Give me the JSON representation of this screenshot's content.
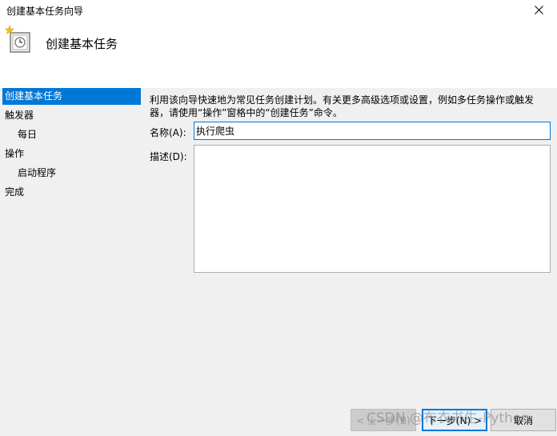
{
  "window": {
    "title": "创建基本任务向导"
  },
  "header": {
    "title": "创建基本任务",
    "icon": "task-scheduler-clock-icon"
  },
  "nav": {
    "items": [
      {
        "label": "创建基本任务",
        "active": true
      },
      {
        "label": "触发器"
      },
      {
        "label": "每日"
      },
      {
        "label": "操作"
      },
      {
        "label": "启动程序"
      },
      {
        "label": "完成"
      }
    ]
  },
  "main": {
    "description": "利用该向导快速地为常见任务创建计划。有关更多高级选项或设置，例如多任务操作或触发器，请使用“操作”窗格中的“创建任务”命令。",
    "name_label": "名称(A):",
    "name_value": "执行爬虫",
    "desc_label": "描述(D):",
    "desc_value": ""
  },
  "buttons": {
    "back": "< 上一步(B)",
    "next": "下一步(N) >",
    "cancel": "取消"
  },
  "watermark": "CSDN @布衣书生-Python",
  "colors": {
    "accent": "#0078d7",
    "pane_bg": "#f0f0f0"
  }
}
